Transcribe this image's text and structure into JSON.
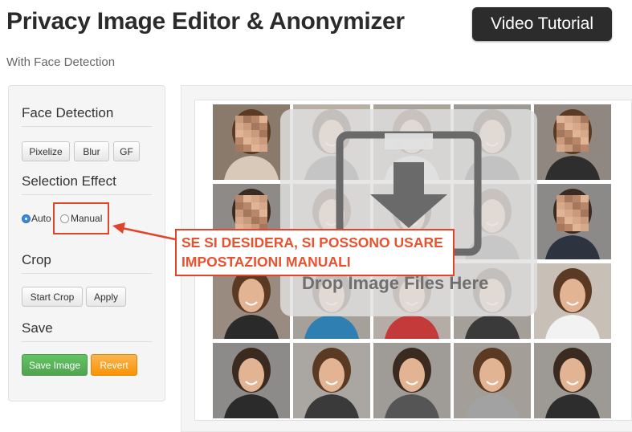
{
  "header": {
    "title": "Privacy Image Editor & Anonymizer",
    "video_button": "Video Tutorial",
    "subtitle": "With Face Detection"
  },
  "sidebar": {
    "face_detection": {
      "title": "Face Detection",
      "buttons": [
        "Pixelize",
        "Blur",
        "GF"
      ]
    },
    "selection_effect": {
      "title": "Selection Effect",
      "options": [
        {
          "label": "Auto",
          "selected": true
        },
        {
          "label": "Manual",
          "selected": false
        }
      ]
    },
    "crop": {
      "title": "Crop",
      "buttons": [
        "Start Crop",
        "Apply"
      ]
    },
    "save": {
      "title": "Save",
      "save_button": "Save Image",
      "revert_button": "Revert"
    }
  },
  "annotation": {
    "line1": "SE SI DESIDERA, SI POSSONO USARE",
    "line2": "IMPOSTAZIONI MANUALI",
    "color": "#e0442a"
  },
  "dropzone": {
    "text": "Drop Image Files Here",
    "icon": "download-arrow-icon"
  },
  "image_grid": {
    "rows": 4,
    "cols": 5,
    "pixelated_faces": [
      [
        0,
        0
      ],
      [
        0,
        4
      ],
      [
        1,
        0
      ],
      [
        1,
        4
      ]
    ],
    "background_colors": [
      [
        "#8a7a6c",
        "#b8b0a6",
        "#a8a39b",
        "#9c9a93",
        "#8f8780"
      ],
      [
        "#8d8a87",
        "#b2aca6",
        "#aaa69e",
        "#a49f96",
        "#8b8a89"
      ],
      [
        "#9a8b80",
        "#a6a09a",
        "#b5ada5",
        "#a49f99",
        "#c8c0b6"
      ],
      [
        "#8d8b89",
        "#aaa6a2",
        "#9f9b97",
        "#a39e98",
        "#9d9995"
      ]
    ],
    "shirt_colors": [
      [
        "#d8c9b9",
        "#4a4a4a",
        "#dcdcdc",
        "#3a3a3a",
        "#2e2e2e"
      ],
      [
        "#3a3a3a",
        "#4a5560",
        "#8a7a6a",
        "#555555",
        "#2d3440"
      ],
      [
        "#2a2a2a",
        "#2f7fb3",
        "#c43a3a",
        "#3a3a3a",
        "#f2f2f2"
      ],
      [
        "#2b2b2b",
        "#3a3a3a",
        "#555555",
        "#a2a2a2",
        "#2d2d2d"
      ]
    ]
  }
}
